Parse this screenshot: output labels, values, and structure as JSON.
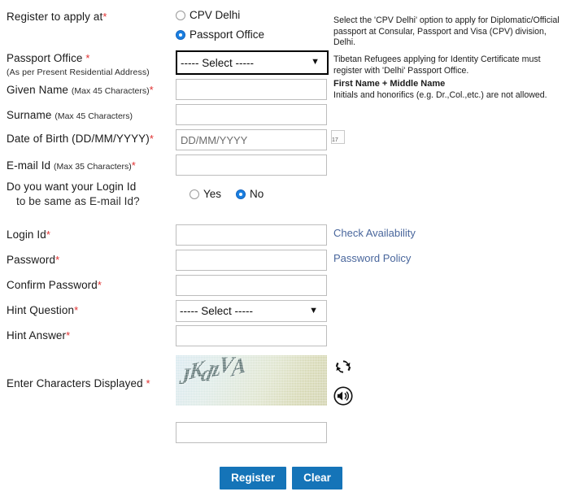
{
  "form": {
    "register_at": {
      "label": "Register to apply at",
      "required": true,
      "options": [
        {
          "label": "CPV Delhi",
          "selected": false
        },
        {
          "label": "Passport Office",
          "selected": true
        }
      ],
      "help": "Select the 'CPV Delhi' option to apply for Diplomatic/Official passport at Consular, Passport and Visa (CPV) division, Delhi."
    },
    "passport_office": {
      "label": "Passport Office",
      "sub_label": "(As per Present Residential Address)",
      "required": true,
      "value": "----- Select -----",
      "options": [
        "----- Select -----"
      ],
      "help": "Tibetan Refugees applying for Identity Certificate must register with 'Delhi' Passport Office."
    },
    "given_name": {
      "label": "Given Name",
      "sub_label": "(Max 45 Characters)",
      "required": true,
      "value": "",
      "help_title": "First Name + Middle Name",
      "help": "Initials and honorifics (e.g. Dr.,Col.,etc.) are not allowed."
    },
    "surname": {
      "label": "Surname",
      "sub_label": "(Max 45 Characters)",
      "required": false,
      "value": ""
    },
    "date_of_birth": {
      "label": "Date of Birth (DD/MM/YYYY)",
      "required": true,
      "value": "",
      "placeholder": "DD/MM/YYYY",
      "calendar_day": "17"
    },
    "email_id": {
      "label": "E-mail Id",
      "sub_label": "(Max 35 Characters)",
      "required": true,
      "value": ""
    },
    "login_same_as_email": {
      "label_line1": "Do you want your Login Id",
      "label_line2": "to be same as E-mail Id?",
      "options": [
        {
          "label": "Yes",
          "selected": false
        },
        {
          "label": "No",
          "selected": true
        }
      ]
    },
    "login_id": {
      "label": "Login Id",
      "required": true,
      "value": "",
      "link": "Check Availability"
    },
    "password": {
      "label": "Password",
      "required": true,
      "value": "",
      "link": "Password Policy"
    },
    "confirm_password": {
      "label": "Confirm Password",
      "required": true,
      "value": ""
    },
    "hint_question": {
      "label": "Hint Question",
      "required": true,
      "value": "----- Select -----",
      "options": [
        "----- Select -----"
      ]
    },
    "hint_answer": {
      "label": "Hint Answer",
      "required": true,
      "value": ""
    },
    "captcha": {
      "label": "Enter Characters Displayed",
      "required": true,
      "image_text": "JKdzVA",
      "value": "",
      "refresh_icon": "refresh-icon",
      "audio_icon": "speaker-icon"
    }
  },
  "actions": {
    "register_label": "Register",
    "clear_label": "Clear"
  },
  "colors": {
    "required_star": "#e03030",
    "link": "#49669c",
    "button": "#1574b8",
    "radio_selected": "#1a7fe0"
  }
}
